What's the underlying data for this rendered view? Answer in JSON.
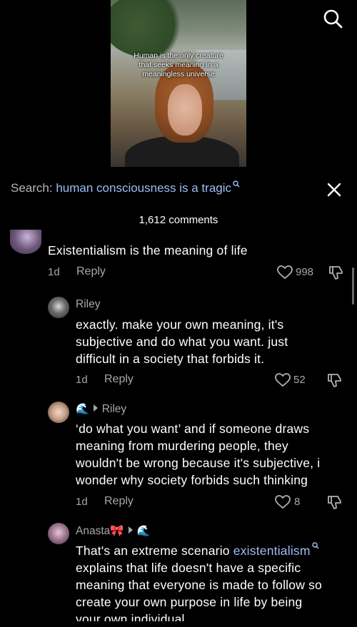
{
  "video": {
    "caption_line1": "Human is the only creature",
    "caption_line2": "that seeks meaning in a",
    "caption_line3": "meaningless universe"
  },
  "search": {
    "label": "Search:",
    "query": "human consciousness is a tragic"
  },
  "comments_header": "1,612 comments",
  "comments": [
    {
      "text": "Existentialism is the meaning of life",
      "age": "1d",
      "reply_label": "Reply",
      "likes": "998"
    },
    {
      "username": "Riley",
      "text_line1": "exactly. make your own meaning, it's",
      "text_line2": "subjective and do what you want. just",
      "text_line3": "difficult in a society that forbids it.",
      "age": "1d",
      "reply_label": "Reply",
      "likes": "52"
    },
    {
      "username_emoji": "🌊",
      "reply_to": "Riley",
      "text_line1": "‘do what you want’ and if someone draws",
      "text_line2": "meaning from murdering people, they",
      "text_line3": "wouldn't be wrong because it's subjective, i",
      "text_line4": "wonder why society forbids such thinking",
      "age": "1d",
      "reply_label": "Reply",
      "likes": "8"
    },
    {
      "username": "Anasta🎀",
      "reply_to_emoji": "🌊",
      "text_line1_a": "That's an extreme scenario ",
      "text_line1_link": "existentialism",
      "text_line2": "explains that life doesn't have a specific",
      "text_line3": "meaning that everyone is made to follow so",
      "text_line4": "create your own purpose in life by being",
      "text_line5": "your own individual"
    }
  ],
  "colors": {
    "background": "#000000",
    "link": "#9fbcf5",
    "secondary_text": "#a8a8a8"
  }
}
